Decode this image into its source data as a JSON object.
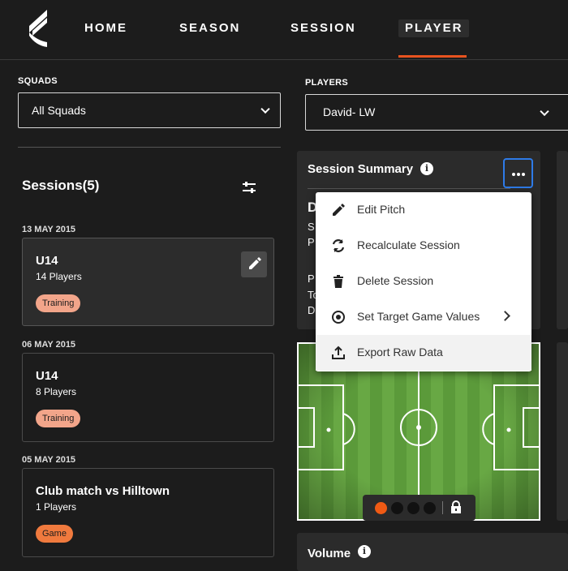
{
  "nav": {
    "items": [
      {
        "label": "HOME"
      },
      {
        "label": "SEASON"
      },
      {
        "label": "SESSION"
      },
      {
        "label": "PLAYER"
      }
    ],
    "accent": "#e8531f"
  },
  "squads": {
    "label": "SQUADS",
    "value": "All Squads"
  },
  "players": {
    "label": "PLAYERS",
    "value": "David- LW"
  },
  "sessions": {
    "title": "Sessions(5)",
    "groups": [
      {
        "date": "13 MAY 2015",
        "title": "U14",
        "players": "14 Players",
        "badge": "Training"
      },
      {
        "date": "06 MAY 2015",
        "title": "U14",
        "players": "8 Players",
        "badge": "Training"
      },
      {
        "date": "05 MAY 2015",
        "title": "Club match vs Hilltown",
        "players": "1 Players",
        "badge": "Game"
      }
    ]
  },
  "summary": {
    "title": "Session Summary",
    "partial_lines": [
      "D",
      "S",
      "P",
      "P",
      "To",
      "D"
    ]
  },
  "menu": {
    "items": [
      {
        "label": "Edit Pitch",
        "icon": "pencil-icon"
      },
      {
        "label": "Recalculate Session",
        "icon": "refresh-icon"
      },
      {
        "label": "Delete Session",
        "icon": "trash-icon"
      },
      {
        "label": "Set Target Game Values",
        "icon": "target-icon"
      },
      {
        "label": "Export Raw Data",
        "icon": "export-icon"
      }
    ]
  },
  "pitch": {
    "carousel_active_index": 0,
    "carousel_count": 4
  },
  "volume": {
    "title": "Volume"
  },
  "colors": {
    "badge_training": "#f2a58a",
    "badge_game": "#f07a3e",
    "focus_ring": "#2e7be8"
  }
}
